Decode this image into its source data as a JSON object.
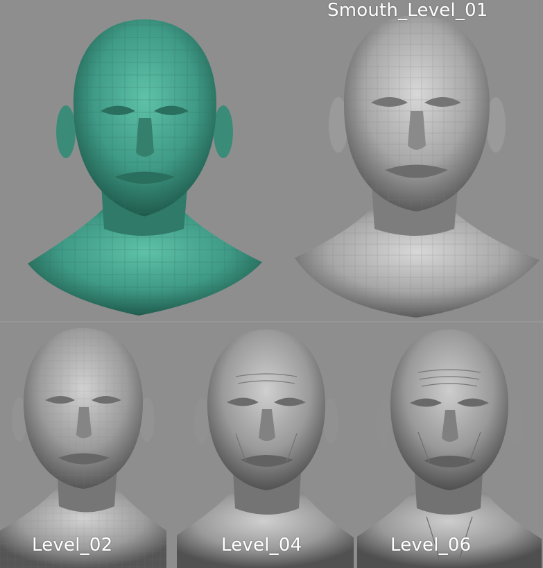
{
  "panels": {
    "base": {
      "label": "",
      "mesh_color": "#3f9a86",
      "shade_color": "#1f5a4c"
    },
    "smooth_01": {
      "label": "Smouth_Level_01",
      "mesh_color": "#a7a7a7",
      "shade_color": "#5a5a5a"
    },
    "level_02": {
      "label": "Level_02",
      "mesh_color": "#9c9c9c",
      "shade_color": "#555555"
    },
    "level_04": {
      "label": "Level_04",
      "mesh_color": "#9a9a9a",
      "shade_color": "#515151"
    },
    "level_06": {
      "label": "Level_06",
      "mesh_color": "#999999",
      "shade_color": "#4f4f4f"
    }
  },
  "background_color": "#8e8e8e"
}
